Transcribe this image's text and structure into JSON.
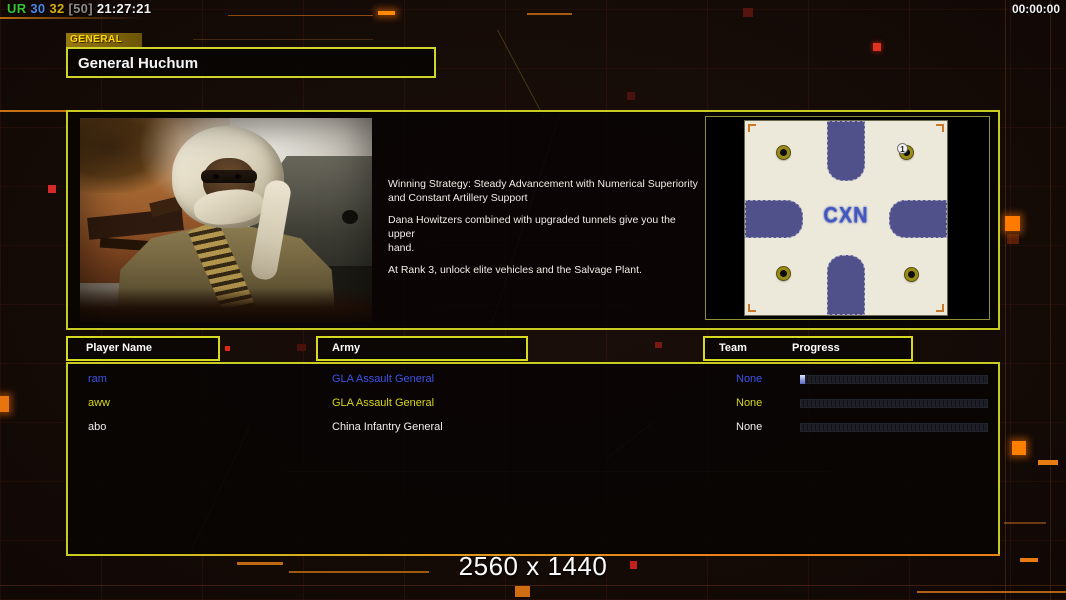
{
  "hud": {
    "net_label": "UR",
    "fps": "30",
    "latency": "32",
    "latency_cap": "[50]",
    "clock": "21:27:21",
    "match_timer": "00:00:00",
    "resolution_watermark": "2560 x 1440"
  },
  "general_panel": {
    "tab_label": "GENERAL",
    "selected_general": "General Huchum",
    "strategy_lines": [
      "Winning Strategy: Steady Advancement with Numerical Superiority\n and Constant Artillery Support",
      "Dana Howitzers combined with upgraded tunnels give you the upper\n hand.",
      "At Rank 3, unlock elite vehicles and the Salvage Plant."
    ]
  },
  "minimap": {
    "center_label": "CXN",
    "start_position_badge": "1"
  },
  "player_table": {
    "headers": {
      "player_name": "Player Name",
      "army": "Army",
      "team": "Team",
      "progress": "Progress"
    },
    "rows": [
      {
        "name": "ram",
        "army": "GLA Assault General",
        "team": "None",
        "color": "#3d52e8",
        "progress_fill": "2.5%"
      },
      {
        "name": "aww",
        "army": "GLA Assault General",
        "team": "None",
        "color": "#d6d61e",
        "progress_fill": "0%"
      },
      {
        "name": "abo",
        "army": "China Infantry General",
        "team": "None",
        "color": "#efefef",
        "progress_fill": "0%"
      }
    ]
  },
  "colors": {
    "box_border_yellow": "#c9cb22",
    "accent_orange": "#e8821a",
    "hud_green": "#33c433",
    "hud_blue": "#4a86e8",
    "hud_yellow": "#d8b00e",
    "hud_gray": "#8a8a8a",
    "hud_white": "#f2f2f2"
  }
}
